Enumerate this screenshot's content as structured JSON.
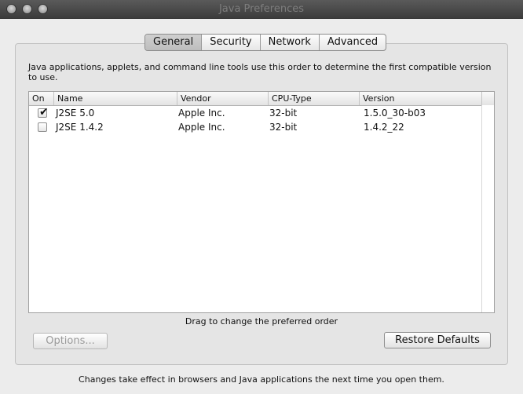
{
  "window": {
    "title": "Java Preferences"
  },
  "tabs": [
    {
      "label": "General",
      "active": true
    },
    {
      "label": "Security",
      "active": false
    },
    {
      "label": "Network",
      "active": false
    },
    {
      "label": "Advanced",
      "active": false
    }
  ],
  "general": {
    "description": "Java applications, applets, and command line tools use this order to determine the first compatible version to use.",
    "table": {
      "columns": [
        "On",
        "Name",
        "Vendor",
        "CPU-Type",
        "Version"
      ],
      "rows": [
        {
          "on": true,
          "name": "J2SE 5.0",
          "vendor": "Apple Inc.",
          "cpu_type": "32-bit",
          "version": "1.5.0_30-b03"
        },
        {
          "on": false,
          "name": "J2SE 1.4.2",
          "vendor": "Apple Inc.",
          "cpu_type": "32-bit",
          "version": "1.4.2_22"
        }
      ]
    },
    "drag_hint": "Drag to change the preferred order",
    "options_button": "Options...",
    "restore_button": "Restore Defaults"
  },
  "footer": "Changes take effect in browsers and Java applications the next time you open them.",
  "icons": {
    "checkmark": "✔"
  }
}
